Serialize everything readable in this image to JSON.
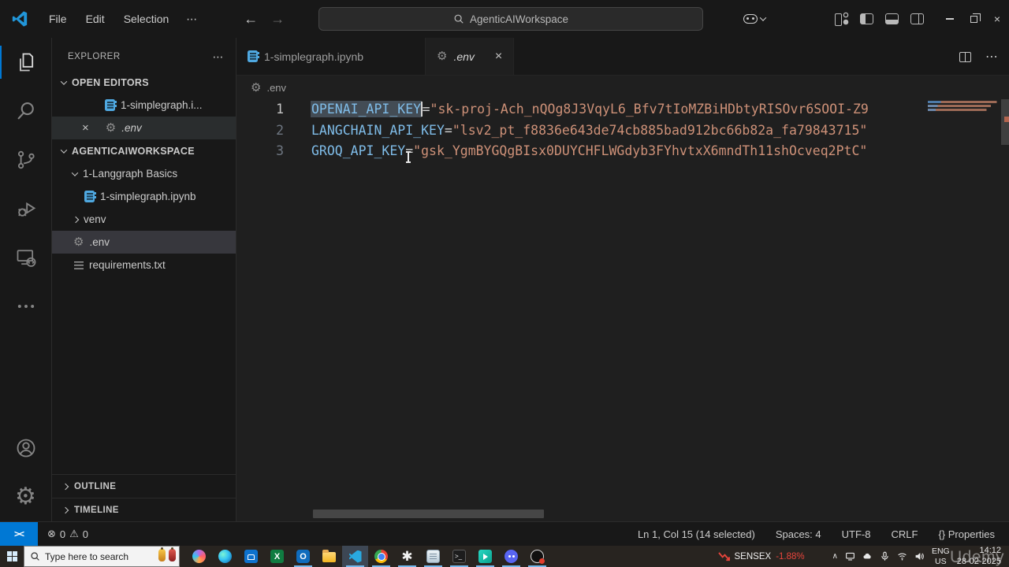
{
  "title_bar": {
    "menus": [
      "File",
      "Edit",
      "Selection"
    ],
    "more": "⋯",
    "search_title": "AgenticAIWorkspace"
  },
  "tabs": {
    "tab1": "1-simplegraph.ipynb",
    "tab2": ".env",
    "close": "×"
  },
  "breadcrumb": {
    "file": ".env"
  },
  "explorer": {
    "title": "EXPLORER",
    "more": "⋯",
    "open_editors_header": "OPEN EDITORS",
    "open_nb": "1-simplegraph.i...",
    "open_env": ".env",
    "open_env_close": "×",
    "workspace": "AGENTICAIWORKSPACE",
    "folder": "1-Langgraph Basics",
    "notebook": "1-simplegraph.ipynb",
    "venv": "venv",
    "env": ".env",
    "requirements": "requirements.txt",
    "outline": "OUTLINE",
    "timeline": "TIMELINE"
  },
  "editor": {
    "eq": "=",
    "lines": [
      {
        "num": "1",
        "key": "OPENAI_API_KEY",
        "value": "\"sk-proj-Ach_nQOg8J3VqyL6_Bfv7tIoMZBiHDbtyRISOvr6SOOI-Z9"
      },
      {
        "num": "2",
        "key": "LANGCHAIN_API_KEY",
        "value": "\"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\""
      },
      {
        "num": "3",
        "key": "GROQ_API_KEY",
        "value": "\"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\""
      }
    ]
  },
  "status_bar": {
    "remote_glyph": "><",
    "errors": "0",
    "warnings": "0",
    "error_icon": "⊗",
    "warning_icon": "⚠",
    "cursor": "Ln 1, Col 15 (14 selected)",
    "indent": "Spaces: 4",
    "encoding": "UTF-8",
    "eol": "CRLF",
    "braces": "{}",
    "language": "Properties"
  },
  "taskbar": {
    "search_placeholder": "Type here to search",
    "icons": [
      "copilot",
      "edge",
      "store",
      "excel",
      "outlook",
      "file-explorer",
      "vscode",
      "chrome",
      "paint-splat",
      "notepad",
      "terminal",
      "clipchamp",
      "discord",
      "obs"
    ],
    "excel_letter": "X",
    "outlook_letter": "O",
    "splat_glyph": "✱",
    "terminal_glyph": ">_",
    "tray": {
      "sensex_label": "SENSEX",
      "sensex_change": "-1.88%",
      "hidden_icons_chevron": "∧",
      "lang_top": "ENG",
      "lang_bottom": "US",
      "time": "14:12",
      "date": "28-02-2025"
    }
  },
  "watermark": "Udemy",
  "colors": {
    "accent_blue": "#0078d4",
    "key_color": "#7fbce8",
    "string_color": "#ce9178",
    "selection": "#434c55",
    "sensex_red": "#e8453c"
  }
}
